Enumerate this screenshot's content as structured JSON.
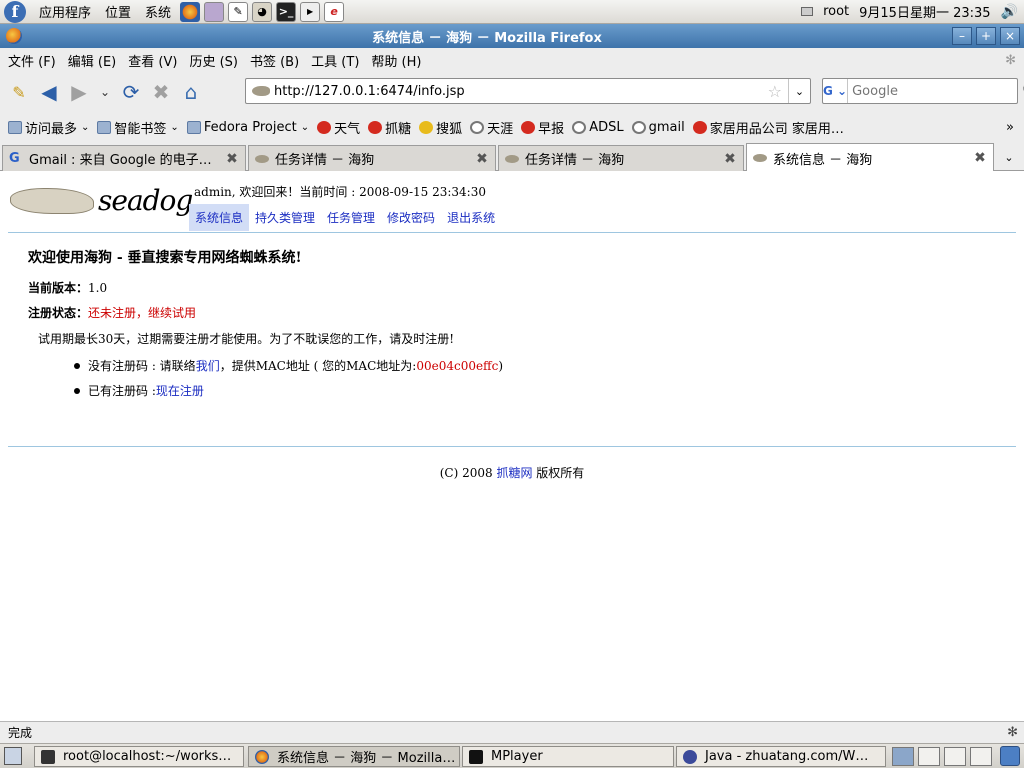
{
  "top_panel": {
    "menus": [
      "应用程序",
      "位置",
      "系统"
    ],
    "user": "root",
    "clock": "9月15日星期一 23:35"
  },
  "window": {
    "title": "系统信息 － 海狗 － Mozilla Firefox"
  },
  "menubar": [
    "文件 (F)",
    "编辑 (E)",
    "查看 (V)",
    "历史 (S)",
    "书签 (B)",
    "工具 (T)",
    "帮助 (H)"
  ],
  "navbar": {
    "url": "http://127.0.0.1:6474/info.jsp",
    "search_placeholder": "Google",
    "search_engine": "G"
  },
  "bookmarks": [
    {
      "label": "访问最多",
      "icon": "folder-icon"
    },
    {
      "label": "智能书签",
      "icon": "folder-icon"
    },
    {
      "label": "Fedora Project",
      "icon": "folder-icon"
    },
    {
      "label": "天气",
      "icon": "weather-icon"
    },
    {
      "label": "抓糖",
      "icon": "zhuatang-icon"
    },
    {
      "label": "搜狐",
      "icon": "sohu-icon"
    },
    {
      "label": "天涯",
      "icon": "globe-icon"
    },
    {
      "label": "早报",
      "icon": "zaobao-icon"
    },
    {
      "label": "ADSL",
      "icon": "globe-icon"
    },
    {
      "label": "gmail",
      "icon": "globe-icon"
    },
    {
      "label": "家居用品公司 家居用…",
      "icon": "home-shop-icon"
    }
  ],
  "bookmarks_more": "»",
  "tabs": [
    {
      "label": "Gmail : 来自 Google 的电子…",
      "icon": "G"
    },
    {
      "label": "任务详情 － 海狗",
      "icon": ""
    },
    {
      "label": "任务详情 － 海狗",
      "icon": ""
    },
    {
      "label": "系统信息 － 海狗",
      "icon": ""
    }
  ],
  "page": {
    "logo_text": "seadog",
    "welcome": "admin, 欢迎回来！当前时间 : 2008-09-15 23:34:30",
    "nav": [
      "系统信息",
      "持久类管理",
      "任务管理",
      "修改密码",
      "退出系统"
    ],
    "heading": "欢迎使用海狗 - 垂直搜索专用网络蜘蛛系统!",
    "version_label": "当前版本：",
    "version_value": "1.0",
    "reg_label": "注册状态：",
    "reg_value": "还未注册，继续试用",
    "trial_note": "试用期最长30天，过期需要注册才能使用。为了不耽误您的工作，请及时注册!",
    "bullet1_prefix": "没有注册码 : 请联络",
    "bullet1_link": "我们",
    "bullet1_mid": "，提供MAC地址 ( 您的MAC地址为: ",
    "bullet1_mac": "00e04c00effc",
    "bullet1_suffix": " )",
    "bullet2_prefix": "已有注册码 : ",
    "bullet2_link": "现在注册",
    "footer_prefix": "(C) 2008 ",
    "footer_link": "抓糖网",
    "footer_suffix": " 版权所有"
  },
  "status": "完成",
  "taskbar": [
    {
      "label": "root@localhost:~/works…"
    },
    {
      "label": "系统信息 － 海狗 － Mozilla…"
    },
    {
      "label": "MPlayer"
    },
    {
      "label": "Java - zhuatang.com/W…"
    }
  ]
}
